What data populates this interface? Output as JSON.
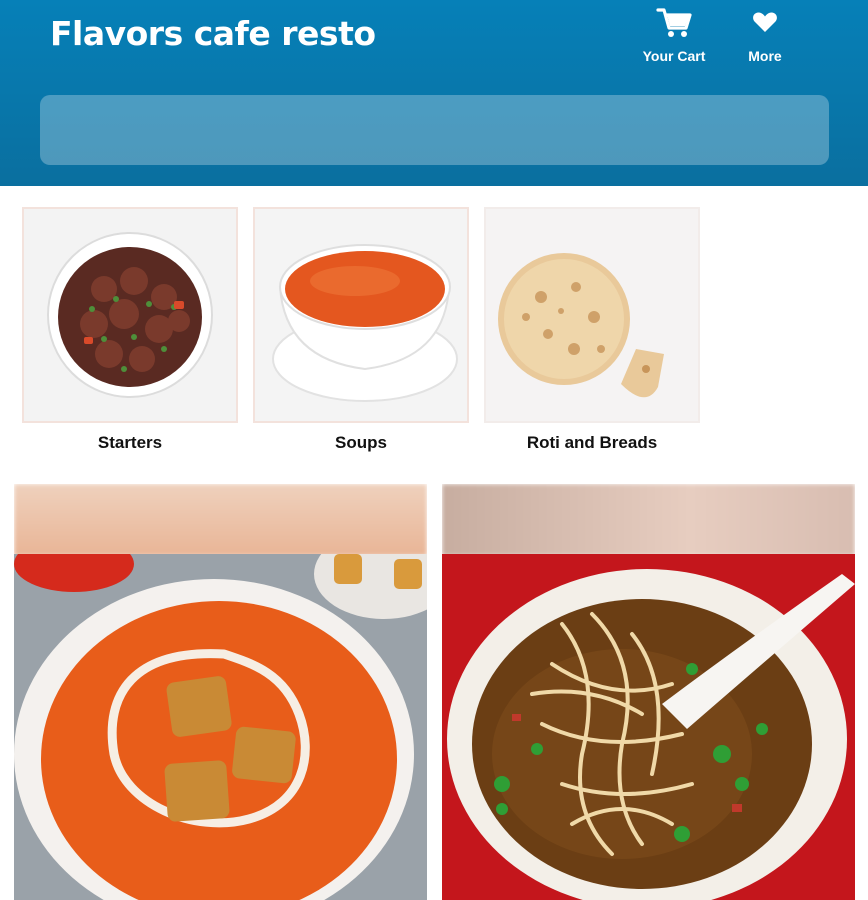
{
  "header": {
    "title": "Flavors cafe resto",
    "cart_label": "Your Cart",
    "more_label": "More",
    "search_placeholder": ""
  },
  "categories": [
    {
      "label": "Starters"
    },
    {
      "label": "Soups"
    },
    {
      "label": "Roti and Breads"
    }
  ],
  "colors": {
    "header_bg": "#0680b8",
    "header_text": "#ffffff",
    "category_text": "#111111"
  },
  "icons": [
    "cart-icon",
    "heart-icon"
  ]
}
